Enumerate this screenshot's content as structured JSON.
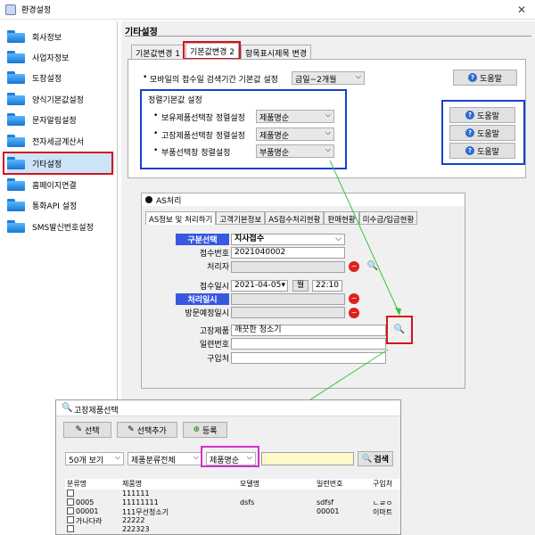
{
  "window": {
    "title": "환경설정",
    "close": "✕"
  },
  "sidebar": {
    "items": [
      {
        "label": "회사정보"
      },
      {
        "label": "사업자정보"
      },
      {
        "label": "도장설정"
      },
      {
        "label": "양식기본값설정"
      },
      {
        "label": "문자알림설정"
      },
      {
        "label": "전자세금계산서"
      },
      {
        "label": "기타설정"
      },
      {
        "label": "홈페이지연결"
      },
      {
        "label": "통화API 설정"
      },
      {
        "label": "SMS발신번호설정"
      }
    ]
  },
  "settings": {
    "title": "기타설정",
    "tabs": [
      {
        "label": "기본값변경 1"
      },
      {
        "label": "기본값변경 2"
      },
      {
        "label": "항목표시제목 변경"
      }
    ],
    "mobile_row": {
      "label": "모바일의 접수일 검색기간 기본값 설정",
      "value": "금일~2개월"
    },
    "help_label": "도움말",
    "sort_group": {
      "title": "정렬기본값 설정",
      "rows": [
        {
          "label": "보유제품선택창 정렬설정",
          "value": "제품명순"
        },
        {
          "label": "고장제품선택창 정렬설정",
          "value": "제품명순"
        },
        {
          "label": "부품선택창 정렬설정",
          "value": "부품명순"
        }
      ]
    }
  },
  "as_window": {
    "title": "AS처리",
    "tabs": [
      "AS정보 및 처리하기",
      "고객기본정보",
      "AS접수처리현황",
      "판매현황",
      "미수금/입금현황"
    ],
    "fields": {
      "category_label": "구분선택",
      "category_value": "지사접수",
      "receipt_no_label": "접수번호",
      "receipt_no_value": "2021040002",
      "handler_label": "처리자",
      "receipt_date_label": "접수일시",
      "receipt_date_value": "2021-04-05",
      "receipt_weekday": "월",
      "receipt_time": "22:10",
      "process_date_label": "처리일시",
      "visit_date_label": "방문예정일시",
      "fault_product_label": "고장제품",
      "fault_product_value": "깨끗한 청소기",
      "serial_label": "일련번호",
      "purchase_label": "구입처"
    }
  },
  "product_window": {
    "title": "고장제품선택",
    "toolbar": {
      "select": "선택",
      "select_add": "선택추가",
      "register": "등록"
    },
    "filters": {
      "page_size": "50개 보기",
      "category": "제품분류전체",
      "sort": "제품명순",
      "search_button": "검색"
    },
    "columns": [
      "분류명",
      "제품명",
      "모델명",
      "일련번호",
      "구입처"
    ],
    "rows": [
      [
        "",
        "111111",
        "",
        "",
        ""
      ],
      [
        "0005",
        "11111111",
        "dsfs",
        "sdfsf",
        "ㄴㄹㅇ"
      ],
      [
        "00001",
        "111무선청소기",
        "",
        "00001",
        "이마트"
      ],
      [
        "가나다라",
        "22222",
        "",
        "",
        ""
      ],
      [
        "",
        "222323",
        "",
        "",
        ""
      ]
    ]
  }
}
